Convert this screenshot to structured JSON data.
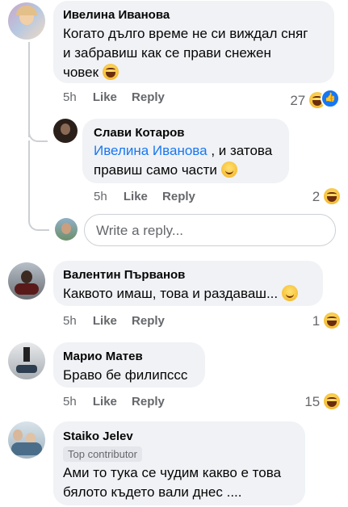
{
  "comments": [
    {
      "author": "Ивелина Иванова",
      "text_line1": "Когато дълго време не си виждал сняг",
      "text_line2": "и забравиш как се прави снежен",
      "text_line3": "човек",
      "time": "5h",
      "like": "Like",
      "reply": "Reply",
      "reaction_count": "27"
    },
    {
      "author": "Слави Котаров",
      "mention": "Ивелина Иванова",
      "text_after_mention": " , и затова",
      "text_line2": "правиш само части",
      "time": "5h",
      "like": "Like",
      "reply": "Reply",
      "reaction_count": "2"
    },
    {
      "author": "Валентин Първанов",
      "text_line1": "Каквото имаш, това и раздаваш...",
      "time": "5h",
      "like": "Like",
      "reply": "Reply",
      "reaction_count": "1"
    },
    {
      "author": "Марио Матев",
      "text_line1": "Браво бе филипссс",
      "time": "5h",
      "like": "Like",
      "reply": "Reply",
      "reaction_count": "15"
    },
    {
      "author": "Staiko Jelev",
      "badge": "Top contributor",
      "text_line1": "Ами то тука се чудим какво е това",
      "text_line2": "бялото където вали днес ...."
    }
  ],
  "reply_input": {
    "placeholder": "Write a reply..."
  },
  "colors": {
    "bubble": "#f0f2f5",
    "meta": "#65676b",
    "link": "#1877f2"
  }
}
